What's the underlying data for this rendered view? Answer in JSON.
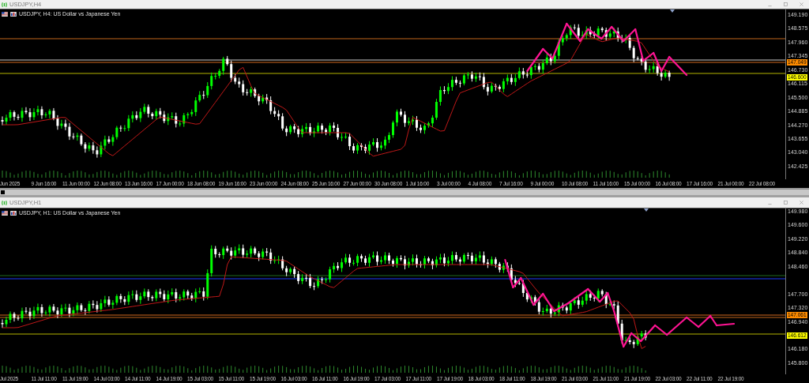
{
  "windows": [
    {
      "title": "USDJPY,H4",
      "chart_label": "USDJPY, H4: US Dollar vs Japanese Yen",
      "price_axis": [
        "149.190",
        "148.575",
        "147.960",
        "147.345",
        "146.730",
        "146.115",
        "145.500",
        "144.885",
        "144.270",
        "143.655",
        "143.040",
        "142.425"
      ],
      "price_tags": [
        {
          "text": "147.049",
          "color": "#ff8c00"
        },
        {
          "text": "146.600",
          "color": "#ffff00"
        }
      ],
      "time_axis": [
        "Jun 2025",
        "9 Jun 16:00",
        "11 Jun 00:00",
        "12 Jun 08:00",
        "13 Jun 16:00",
        "17 Jun 00:00",
        "18 Jun 08:00",
        "19 Jun 16:00",
        "23 Jun 00:00",
        "24 Jun 08:00",
        "25 Jun 16:00",
        "27 Jun 00:00",
        "30 Jun 08:00",
        "1 Jul 16:00",
        "3 Jul 00:00",
        "4 Jul 08:00",
        "7 Jul 16:00",
        "9 Jul 00:00",
        "10 Jul 08:00",
        "11 Jul 16:00",
        "15 Jul 00:00",
        "16 Jul 08:00",
        "17 Jul 16:00",
        "21 Jul 00:00",
        "22 Jul 08:00"
      ]
    },
    {
      "title": "USDJPY,H1",
      "chart_label": "USDJPY, H1: US Dollar vs Japanese Yen",
      "price_axis": [
        "149.980",
        "149.600",
        "149.220",
        "148.840",
        "148.460",
        "147.700",
        "147.320",
        "146.940",
        "146.180",
        "145.800"
      ],
      "price_tags": [
        {
          "text": "147.061",
          "color": "#ff8c00"
        },
        {
          "text": "146.612",
          "color": "#ffff00"
        }
      ],
      "time_axis": [
        "Jul 2025",
        "11 Jul 11:00",
        "11 Jul 19:00",
        "14 Jul 03:00",
        "14 Jul 11:00",
        "14 Jul 19:00",
        "15 Jul 03:00",
        "15 Jul 11:00",
        "15 Jul 19:00",
        "16 Jul 03:00",
        "16 Jul 11:00",
        "16 Jul 19:00",
        "17 Jul 03:00",
        "17 Jul 11:00",
        "17 Jul 19:00",
        "18 Jul 03:00",
        "18 Jul 11:00",
        "18 Jul 19:00",
        "21 Jul 03:00",
        "21 Jul 11:00",
        "21 Jul 19:00",
        "22 Jul 03:00",
        "22 Jul 11:00",
        "22 Jul 19:00"
      ]
    }
  ]
}
